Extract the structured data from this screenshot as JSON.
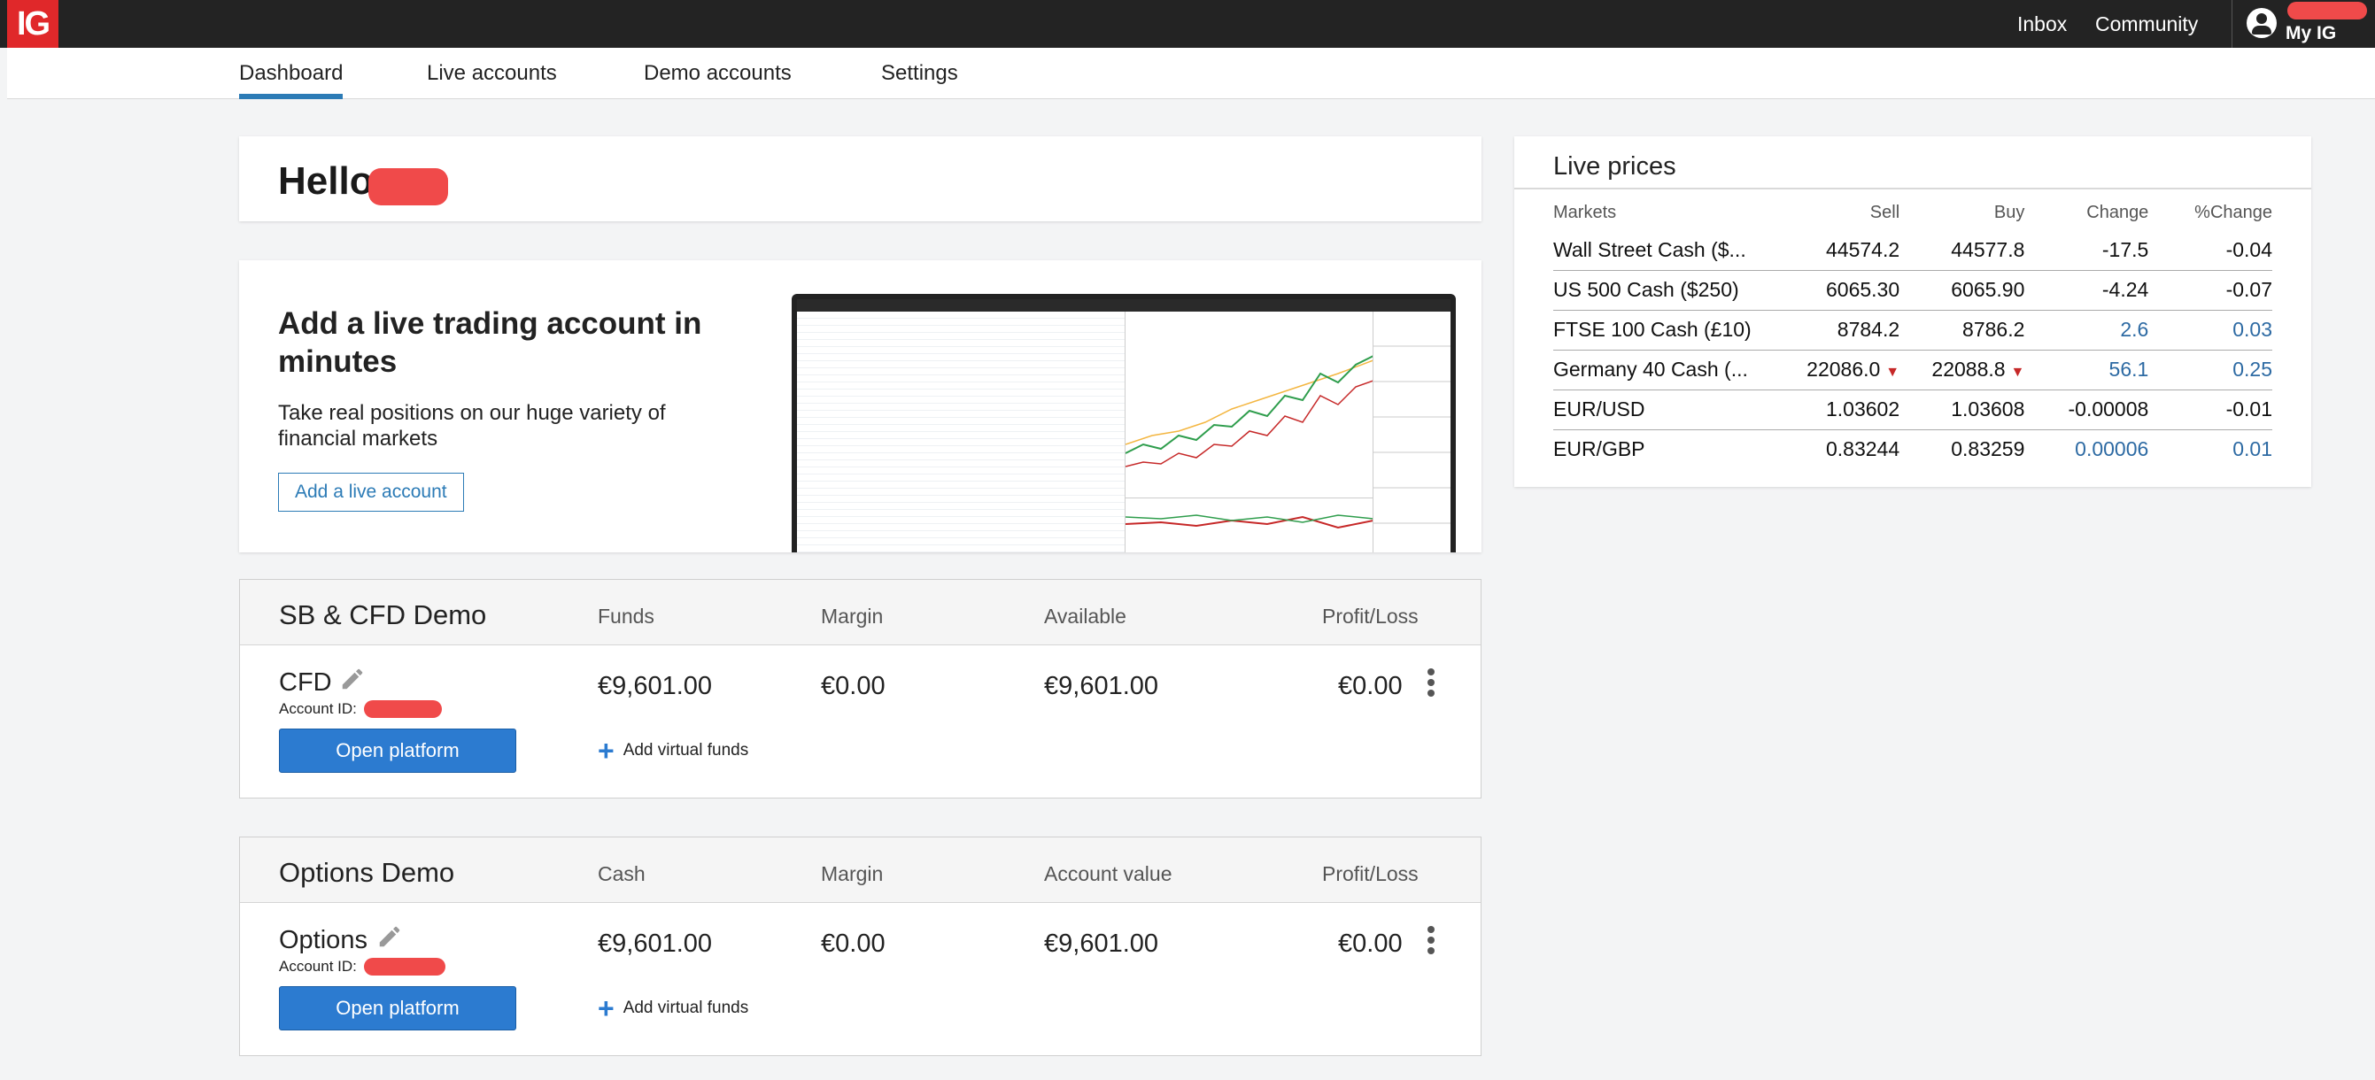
{
  "topbar": {
    "logo": "IG",
    "inbox": "Inbox",
    "community": "Community",
    "my_ig": "My IG"
  },
  "subnav": {
    "tabs": [
      "Dashboard",
      "Live accounts",
      "Demo accounts",
      "Settings"
    ],
    "active": "Dashboard",
    "accent_color": "#2c7bb6"
  },
  "hello": {
    "greeting": "Hello"
  },
  "promo": {
    "heading": "Add a live trading account in minutes",
    "body": "Take real positions on our huge variety of financial markets",
    "button": "Add a live account"
  },
  "accounts": [
    {
      "title": "SB & CFD Demo",
      "columns": [
        "Funds",
        "Margin",
        "Available",
        "Profit/Loss"
      ],
      "name": "CFD",
      "account_id_label": "Account ID:",
      "values": [
        "€9,601.00",
        "€0.00",
        "€9,601.00",
        "€0.00"
      ],
      "open_button": "Open platform",
      "add_funds": "Add virtual funds"
    },
    {
      "title": "Options Demo",
      "columns": [
        "Cash",
        "Margin",
        "Account value",
        "Profit/Loss"
      ],
      "name": "Options",
      "account_id_label": "Account ID:",
      "values": [
        "€9,601.00",
        "€0.00",
        "€9,601.00",
        "€0.00"
      ],
      "open_button": "Open platform",
      "add_funds": "Add virtual funds"
    }
  ],
  "live_prices": {
    "title": "Live prices",
    "headers": [
      "Markets",
      "Sell",
      "Buy",
      "Change",
      "%Change"
    ],
    "rows": [
      {
        "market": "Wall Street Cash ($...",
        "sell": "44574.2",
        "buy": "44577.8",
        "change": "-17.5",
        "pct": "-0.04",
        "positive": false,
        "sell_down": false,
        "buy_down": false
      },
      {
        "market": "US 500 Cash ($250)",
        "sell": "6065.30",
        "buy": "6065.90",
        "change": "-4.24",
        "pct": "-0.07",
        "positive": false,
        "sell_down": false,
        "buy_down": false
      },
      {
        "market": "FTSE 100 Cash (£10)",
        "sell": "8784.2",
        "buy": "8786.2",
        "change": "2.6",
        "pct": "0.03",
        "positive": true,
        "sell_down": false,
        "buy_down": false
      },
      {
        "market": "Germany 40 Cash (...",
        "sell": "22086.0",
        "buy": "22088.8",
        "change": "56.1",
        "pct": "0.25",
        "positive": true,
        "sell_down": true,
        "buy_down": true
      },
      {
        "market": "EUR/USD",
        "sell": "1.03602",
        "buy": "1.03608",
        "change": "-0.00008",
        "pct": "-0.01",
        "positive": false,
        "sell_down": false,
        "buy_down": false
      },
      {
        "market": "EUR/GBP",
        "sell": "0.83244",
        "buy": "0.83259",
        "change": "0.00006",
        "pct": "0.01",
        "positive": true,
        "sell_down": false,
        "buy_down": false
      }
    ],
    "positive_color": "#2d6aa3",
    "down_color": "#c62828"
  }
}
